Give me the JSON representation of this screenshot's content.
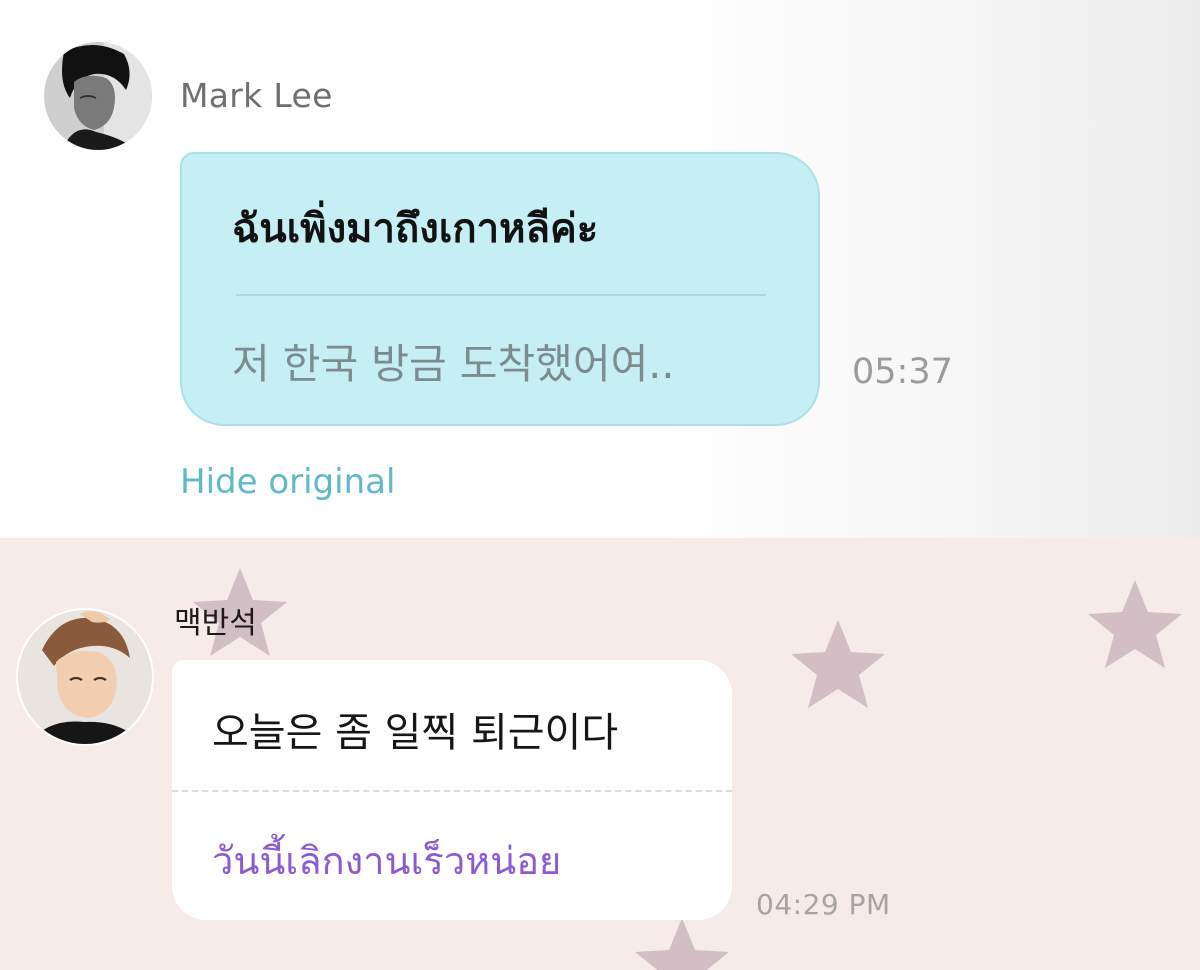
{
  "messages": [
    {
      "sender": "Mark Lee",
      "translated_text": "ฉันเพิ่งมาถึงเกาหลีค่ะ",
      "original_text": "저 한국 방금 도착했어여..",
      "time": "05:37",
      "action_label": "Hide original",
      "bubble_color": "#c6eff5",
      "action_color": "#5fb9c8"
    },
    {
      "sender": "맥반석",
      "original_text": "오늘은 좀 일찍 퇴근이다",
      "translated_text": "วันนี้เลิกงานเร็วหน่อย",
      "time": "04:29 PM",
      "bubble_color": "#ffffff",
      "translated_color": "#8b5bd6",
      "background_color": "#f7ebea"
    }
  ]
}
